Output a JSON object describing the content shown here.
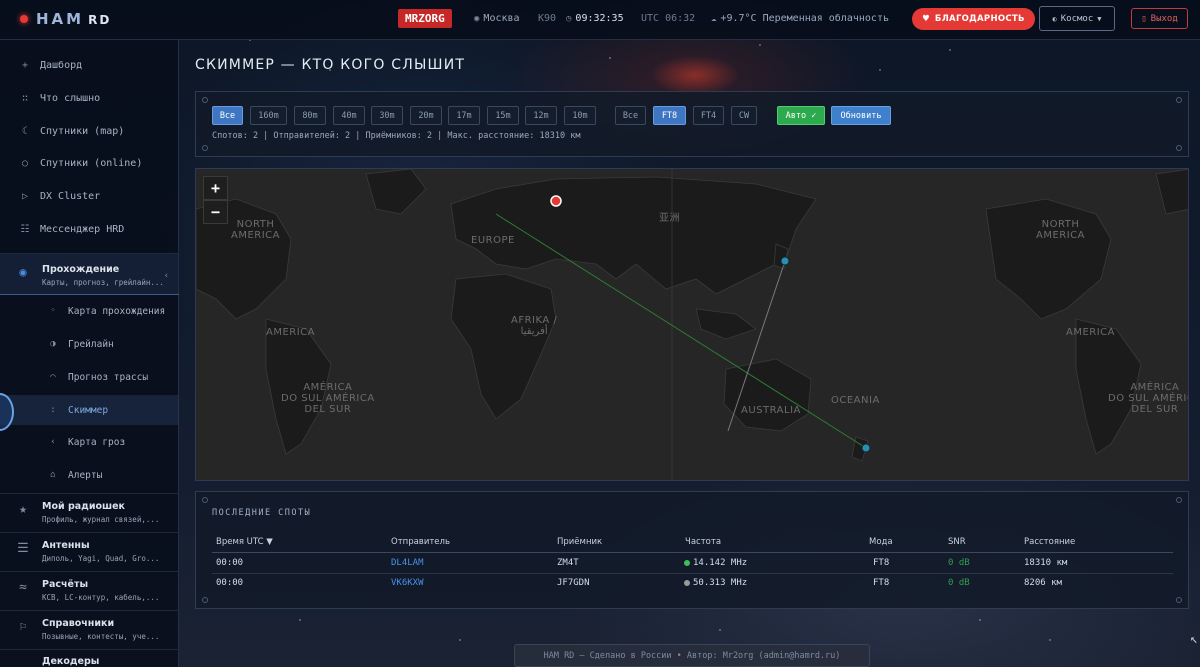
{
  "app": {
    "logo": "HAM",
    "logo_suffix": "RD"
  },
  "topbar": {
    "callsign": "MRZORG",
    "city": "Москва",
    "grid": "K90",
    "local_time": "09:32:35",
    "utc_label": "UTC 06:32",
    "weather": "+9.7°C Переменная облачность",
    "thanks_label": "БЛАГОДАРНОСТЬ",
    "theme_label": "Космос",
    "exit_label": "Выход"
  },
  "sidebar": {
    "items": [
      {
        "label": "Дашборд",
        "icon": "plus-icon"
      },
      {
        "label": "Что слышно",
        "icon": "dots-icon"
      },
      {
        "label": "Спутники (map)",
        "icon": "moon-icon"
      },
      {
        "label": "Спутники (online)",
        "icon": "circle-icon"
      },
      {
        "label": "DX Cluster",
        "icon": "triangle-icon"
      },
      {
        "label": "Мессенджер HRD",
        "icon": "list-icon"
      }
    ],
    "active_group": {
      "title": "Прохождение",
      "desc": "Карты, прогноз, грейлайн..."
    },
    "sub_items": [
      {
        "label": "Карта прохождения"
      },
      {
        "label": "Грейлайн"
      },
      {
        "label": "Прогноз трассы"
      },
      {
        "label": "Скиммер"
      },
      {
        "label": "Карта гроз"
      },
      {
        "label": "Алерты"
      }
    ],
    "groups": [
      {
        "title": "Мой радиошек",
        "desc": "Профиль, журнал связей,..."
      },
      {
        "title": "Антенны",
        "desc": "Диполь, Yagi, Quad, Gro..."
      },
      {
        "title": "Расчёты",
        "desc": "КСВ, LC-контур, кабель,..."
      },
      {
        "title": "Справочники",
        "desc": "Позывные, контесты, уче..."
      },
      {
        "title": "Декодеры",
        "desc": ""
      }
    ]
  },
  "page": {
    "title": "СКИММЕР — КТО КОГО СЛЫШИТ"
  },
  "filters": {
    "bands": [
      "Все",
      "160m",
      "80m",
      "40m",
      "30m",
      "20m",
      "17m",
      "15m",
      "12m",
      "10m"
    ],
    "active_band": "Все",
    "modes": [
      "Все",
      "FT8",
      "FT4",
      "CW"
    ],
    "active_mode": "FT8",
    "auto_label": "Авто ✓",
    "refresh_label": "Обновить",
    "stats": "Спотов: 2 | Отправителей: 2 | Приёмников: 2 | Макс. расстояние: 18310 км"
  },
  "map": {
    "zoom_in": "+",
    "zoom_out": "−",
    "labels": {
      "north_america_l": "NORTH\nAMERICA",
      "europe": "EUROPE",
      "asia": "亚洲",
      "north_america_r": "NORTH\nAMERICA",
      "america_l": "AMERICA",
      "africa": "AFRIKA /\nأفريقيا",
      "america_r": "AMERICA",
      "sa_l": "AMÉRICA\nDO SUL AMÉRICA\nDEL SUR",
      "australia": "AUSTRALIA",
      "oceania": "OCEANIA",
      "sa_r": "AMÉRICA\nDO SUL AMÉRICA\nDEL SUR"
    }
  },
  "spots": {
    "title": "ПОСЛЕДНИЕ СПОТЫ",
    "columns": [
      "Время UTC ▼",
      "Отправитель",
      "Приёмник",
      "Частота",
      "Мода",
      "SNR",
      "Расстояние"
    ],
    "rows": [
      {
        "time": "00:00",
        "sender": "DL4LAM",
        "receiver": "ZM4T",
        "freq": "14.142 MHz",
        "freq_color": "#3fbf5a",
        "mode": "FT8",
        "snr": "0 dB",
        "distance": "18310 км"
      },
      {
        "time": "00:00",
        "sender": "VK6KXW",
        "receiver": "JF7GDN",
        "freq": "50.313 MHz",
        "freq_color": "#9a9a9a",
        "mode": "FT8",
        "snr": "0 dB",
        "distance": "8206 км"
      }
    ]
  },
  "footer": {
    "text": "HAM RD — Сделано в России • Автор: Mr2org (admin@hamrd.ru)"
  },
  "colors": {
    "accent": "#e53935",
    "active_blue": "#3f76c4",
    "green": "#2eaa4e"
  }
}
